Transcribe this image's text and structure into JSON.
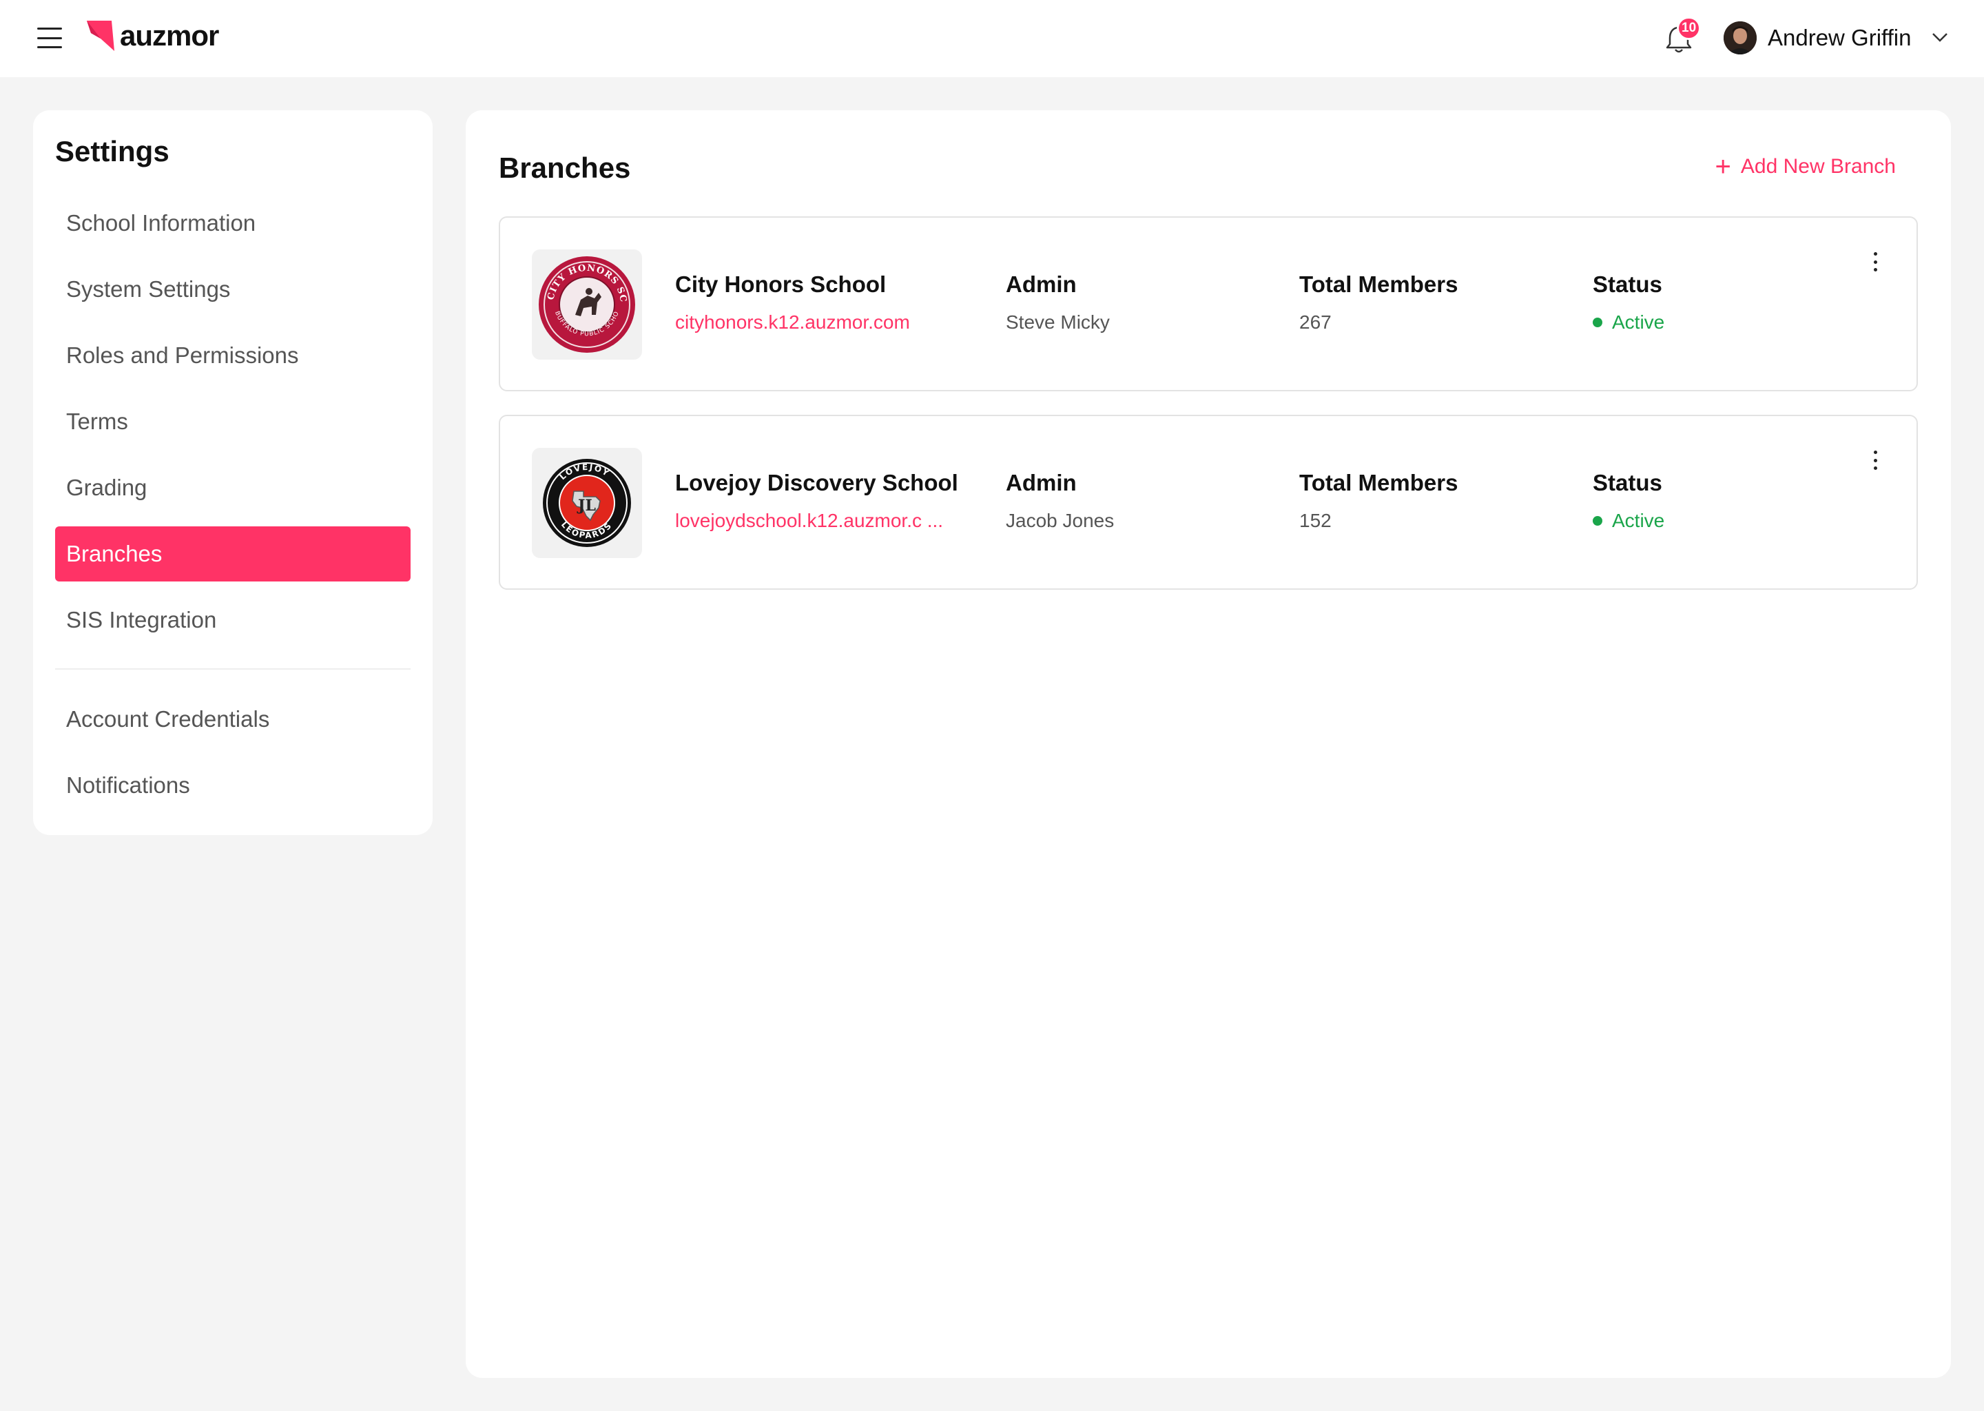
{
  "app": {
    "brand": "auzmor",
    "notification_count": "10",
    "user_name": "Andrew Griffin",
    "accent_color": "#ff3366"
  },
  "sidebar": {
    "title": "Settings",
    "items": [
      {
        "label": "School Information"
      },
      {
        "label": "System Settings"
      },
      {
        "label": "Roles and Permissions"
      },
      {
        "label": "Terms"
      },
      {
        "label": "Grading"
      },
      {
        "label": "Branches",
        "active": true
      },
      {
        "label": "SIS Integration"
      },
      {
        "label": "Account Credentials"
      },
      {
        "label": "Notifications"
      }
    ]
  },
  "main": {
    "title": "Branches",
    "add_button_label": "Add New Branch",
    "column_labels": {
      "admin": "Admin",
      "members": "Total Members",
      "status": "Status"
    },
    "branches": [
      {
        "name": "City Honors School",
        "url": "cityhonors.k12.auzmor.com",
        "admin": "Steve Micky",
        "members": "267",
        "status": "Active",
        "logo_icon": "city-honors-school-logo"
      },
      {
        "name": "Lovejoy Discovery School",
        "url": "lovejoydschool.k12.auzmor.c ...",
        "admin": "Jacob Jones",
        "members": "152",
        "status": "Active",
        "logo_icon": "lovejoy-leopards-logo"
      }
    ]
  }
}
